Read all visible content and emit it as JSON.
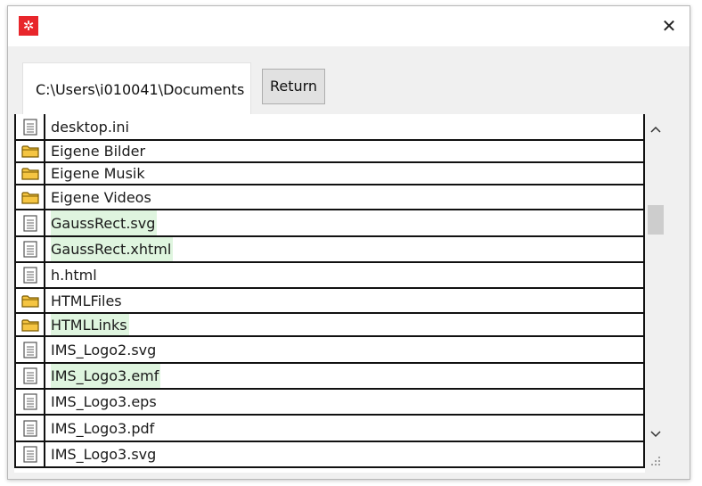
{
  "window": {
    "close_glyph": "✕",
    "app_icon": "app-gear-icon",
    "accent": "#e8262b"
  },
  "path": {
    "value": "C:\\Users\\i010041\\Documents"
  },
  "toolbar": {
    "return_label": "Return"
  },
  "list": {
    "items": [
      {
        "name": "desktop.ini",
        "type": "file",
        "highlight": false
      },
      {
        "name": "Eigene Bilder",
        "type": "folder",
        "highlight": false
      },
      {
        "name": "Eigene Musik",
        "type": "folder",
        "highlight": false
      },
      {
        "name": "Eigene Videos",
        "type": "folder",
        "highlight": false
      },
      {
        "name": "GaussRect.svg",
        "type": "file",
        "highlight": true
      },
      {
        "name": "GaussRect.xhtml",
        "type": "file",
        "highlight": true
      },
      {
        "name": "h.html",
        "type": "file",
        "highlight": false
      },
      {
        "name": "HTMLFiles",
        "type": "folder",
        "highlight": false
      },
      {
        "name": "HTMLLinks",
        "type": "folder",
        "highlight": true
      },
      {
        "name": "IMS_Logo2.svg",
        "type": "file",
        "highlight": false
      },
      {
        "name": "IMS_Logo3.emf",
        "type": "file",
        "highlight": true
      },
      {
        "name": "IMS_Logo3.eps",
        "type": "file",
        "highlight": false
      },
      {
        "name": "IMS_Logo3.pdf",
        "type": "file",
        "highlight": false
      },
      {
        "name": "IMS_Logo3.svg",
        "type": "file",
        "highlight": false
      }
    ]
  },
  "scrollbar": {
    "up_glyph": "^",
    "down_glyph": "⌄"
  },
  "colors": {
    "highlight": "#dff5df",
    "folder": "#f5c542",
    "border": "#111111"
  }
}
